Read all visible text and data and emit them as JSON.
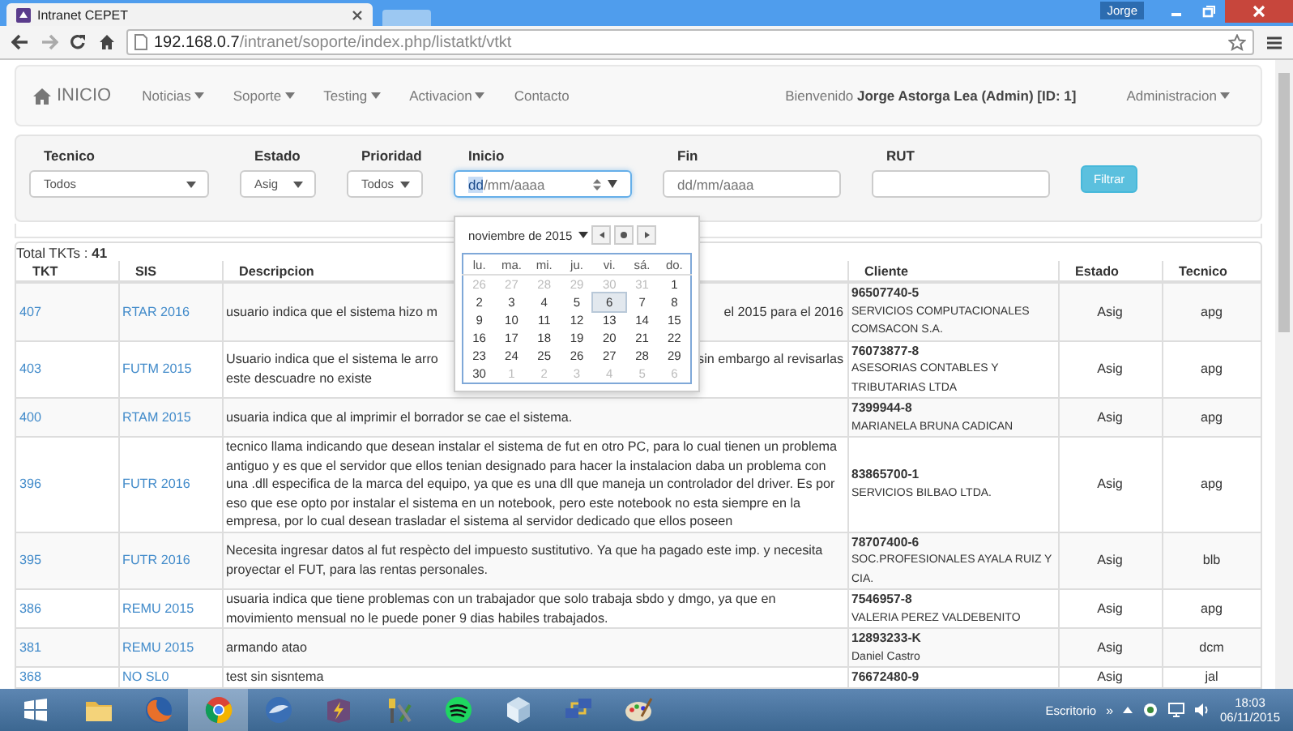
{
  "browser": {
    "tab": {
      "title": "Intranet CEPET"
    },
    "profile": "Jorge",
    "url": {
      "host": "192.168.0.7",
      "path": "/intranet/soporte/index.php/listatkt/vtkt"
    }
  },
  "navbar": {
    "brand": "INICIO",
    "items": [
      {
        "label": "Noticias",
        "dropdown": true
      },
      {
        "label": "Soporte",
        "dropdown": true
      },
      {
        "label": "Testing",
        "dropdown": true
      },
      {
        "label": "Activacion",
        "dropdown": true
      },
      {
        "label": "Contacto",
        "dropdown": false
      }
    ],
    "welcome": "Bienvenido **Jorge Astorga Lea (Admin) [ID: 1]**",
    "admin": {
      "label": "Administracion",
      "dropdown": true
    }
  },
  "filters": {
    "tecnico": {
      "label": "Tecnico",
      "value": "Todos"
    },
    "estado": {
      "label": "Estado",
      "value": "Asig"
    },
    "prioridad": {
      "label": "Prioridad",
      "value": "Todos"
    },
    "inicio": {
      "label": "Inicio",
      "value_selected": "dd",
      "value_rest": "/mm/aaaa",
      "focused": true
    },
    "fin": {
      "label": "Fin",
      "placeholder": "dd/mm/aaaa"
    },
    "rut": {
      "label": "RUT"
    },
    "button": "Filtrar"
  },
  "datepicker": {
    "month": "noviembre de 2015",
    "weekdays": [
      "lu.",
      "ma.",
      "mi.",
      "ju.",
      "vi.",
      "sá.",
      "do."
    ],
    "weeks": [
      [
        {
          "day": "26",
          "muted": true,
          "selected": false
        },
        {
          "day": "27",
          "muted": true,
          "selected": false
        },
        {
          "day": "28",
          "muted": true,
          "selected": false
        },
        {
          "day": "29",
          "muted": true,
          "selected": false
        },
        {
          "day": "30",
          "muted": true,
          "selected": false
        },
        {
          "day": "31",
          "muted": true,
          "selected": false
        },
        {
          "day": "1",
          "muted": false,
          "selected": false
        }
      ],
      [
        {
          "day": "2",
          "muted": false,
          "selected": false
        },
        {
          "day": "3",
          "muted": false,
          "selected": false
        },
        {
          "day": "4",
          "muted": false,
          "selected": false
        },
        {
          "day": "5",
          "muted": false,
          "selected": false
        },
        {
          "day": "6",
          "muted": false,
          "selected": true
        },
        {
          "day": "7",
          "muted": false,
          "selected": false
        },
        {
          "day": "8",
          "muted": false,
          "selected": false
        }
      ],
      [
        {
          "day": "9",
          "muted": false,
          "selected": false
        },
        {
          "day": "10",
          "muted": false,
          "selected": false
        },
        {
          "day": "11",
          "muted": false,
          "selected": false
        },
        {
          "day": "12",
          "muted": false,
          "selected": false
        },
        {
          "day": "13",
          "muted": false,
          "selected": false
        },
        {
          "day": "14",
          "muted": false,
          "selected": false
        },
        {
          "day": "15",
          "muted": false,
          "selected": false
        }
      ],
      [
        {
          "day": "16",
          "muted": false,
          "selected": false
        },
        {
          "day": "17",
          "muted": false,
          "selected": false
        },
        {
          "day": "18",
          "muted": false,
          "selected": false
        },
        {
          "day": "19",
          "muted": false,
          "selected": false
        },
        {
          "day": "20",
          "muted": false,
          "selected": false
        },
        {
          "day": "21",
          "muted": false,
          "selected": false
        },
        {
          "day": "22",
          "muted": false,
          "selected": false
        }
      ],
      [
        {
          "day": "23",
          "muted": false,
          "selected": false
        },
        {
          "day": "24",
          "muted": false,
          "selected": false
        },
        {
          "day": "25",
          "muted": false,
          "selected": false
        },
        {
          "day": "26",
          "muted": false,
          "selected": false
        },
        {
          "day": "27",
          "muted": false,
          "selected": false
        },
        {
          "day": "28",
          "muted": false,
          "selected": false
        },
        {
          "day": "29",
          "muted": false,
          "selected": false
        }
      ],
      [
        {
          "day": "30",
          "muted": false,
          "selected": false
        },
        {
          "day": "1",
          "muted": true,
          "selected": false
        },
        {
          "day": "2",
          "muted": true,
          "selected": false
        },
        {
          "day": "3",
          "muted": true,
          "selected": false
        },
        {
          "day": "4",
          "muted": true,
          "selected": false
        },
        {
          "day": "5",
          "muted": true,
          "selected": false
        },
        {
          "day": "6",
          "muted": true,
          "selected": false
        }
      ]
    ]
  },
  "table": {
    "total": "Total TKTs : **41**",
    "columns": [
      "TKT",
      "SIS",
      "Descripcion",
      "Cliente",
      "Estado",
      "Tecnico"
    ],
    "rows": [
      {
        "tkt": "407",
        "sis": "RTAR 2016",
        "descripcion_left": [
          "usuario indica que el sistema hizo m"
        ],
        "descripcion_right": [
          "el 2015 para el 2016"
        ],
        "rut": "96507740-5",
        "cliente": "SERVICIOS COMPUTACIONALES COMSACON S.A.",
        "estado": "Asig",
        "tecnico": "apg"
      },
      {
        "tkt": "403",
        "sis": "FUTM 2015",
        "descripcion_left": [
          "Usuario indica que el sistema le arro",
          "este descuadre no existe"
        ],
        "descripcion_right": [
          "sin embargo al revisarlas"
        ],
        "rut": "76073877-8",
        "cliente": "ASESORIAS CONTABLES Y TRIBUTARIAS LTDA",
        "estado": "Asig",
        "tecnico": "apg"
      },
      {
        "tkt": "400",
        "sis": "RTAM 2015",
        "descripcion": "usuaria indica que al imprimir el borrador se cae el sistema.",
        "rut": "7399944-8",
        "cliente": "MARIANELA BRUNA CADICAN",
        "estado": "Asig",
        "tecnico": "apg"
      },
      {
        "tkt": "396",
        "sis": "FUTR 2016",
        "descripcion": "tecnico llama indicando que desean instalar el sistema de fut en otro PC, para lo cual tienen un problema antiguo y es que el servidor que ellos tenian designado para hacer la instalacion daba un problema con una .dll especifica de la marca del equipo, ya que es una dll que maneja un controlador del driver. Es por eso que ese opto por instalar el sistema en un notebook, pero este notebook no esta siempre en la empresa, por lo cual desean trasladar el sistema al servidor dedicado que ellos poseen",
        "rut": "83865700-1",
        "cliente": "SERVICIOS BILBAO LTDA.",
        "estado": "Asig",
        "tecnico": "apg"
      },
      {
        "tkt": "395",
        "sis": "FUTR 2016",
        "descripcion": "Necesita ingresar datos al fut respècto del impuesto sustitutivo. Ya que ha pagado este imp. y necesita proyectar el FUT, para las rentas personales.",
        "rut": "78707400-6",
        "cliente": "SOC.PROFESIONALES AYALA RUIZ Y CIA.",
        "estado": "Asig",
        "tecnico": "blb"
      },
      {
        "tkt": "386",
        "sis": "REMU 2015",
        "descripcion": "usuaria indica que tiene problemas con un trabajador que solo trabaja sbdo y dmgo, ya que en movimiento mensual no le puede poner 9 dias habiles trabajados.",
        "rut": "7546957-8",
        "cliente": "VALERIA PEREZ VALDEBENITO",
        "estado": "Asig",
        "tecnico": "apg"
      },
      {
        "tkt": "381",
        "sis": "REMU 2015",
        "descripcion": "armando atao",
        "rut": "12893233-K",
        "cliente": "Daniel Castro",
        "estado": "Asig",
        "tecnico": "dcm"
      },
      {
        "tkt": "368",
        "sis": "NO SL0",
        "descripcion": "test sin sisntema",
        "rut": "76672480-9",
        "estado": "Asig",
        "tecnico": "jal"
      }
    ]
  },
  "taskbar": {
    "apps": [
      {
        "kind": "folder",
        "active": false
      },
      {
        "kind": "firefox",
        "active": false
      },
      {
        "kind": "chrome",
        "active": true
      },
      {
        "kind": "thunderbird",
        "active": false
      },
      {
        "kind": "box",
        "active": false
      },
      {
        "kind": "tools",
        "active": false
      },
      {
        "kind": "spotify",
        "active": false
      },
      {
        "kind": "cube",
        "active": false
      },
      {
        "kind": "network",
        "active": false
      },
      {
        "kind": "paint",
        "active": false
      }
    ],
    "desktop_label": "Escritorio",
    "overflow": "»",
    "time": "18:03",
    "date": "06/11/2015"
  }
}
